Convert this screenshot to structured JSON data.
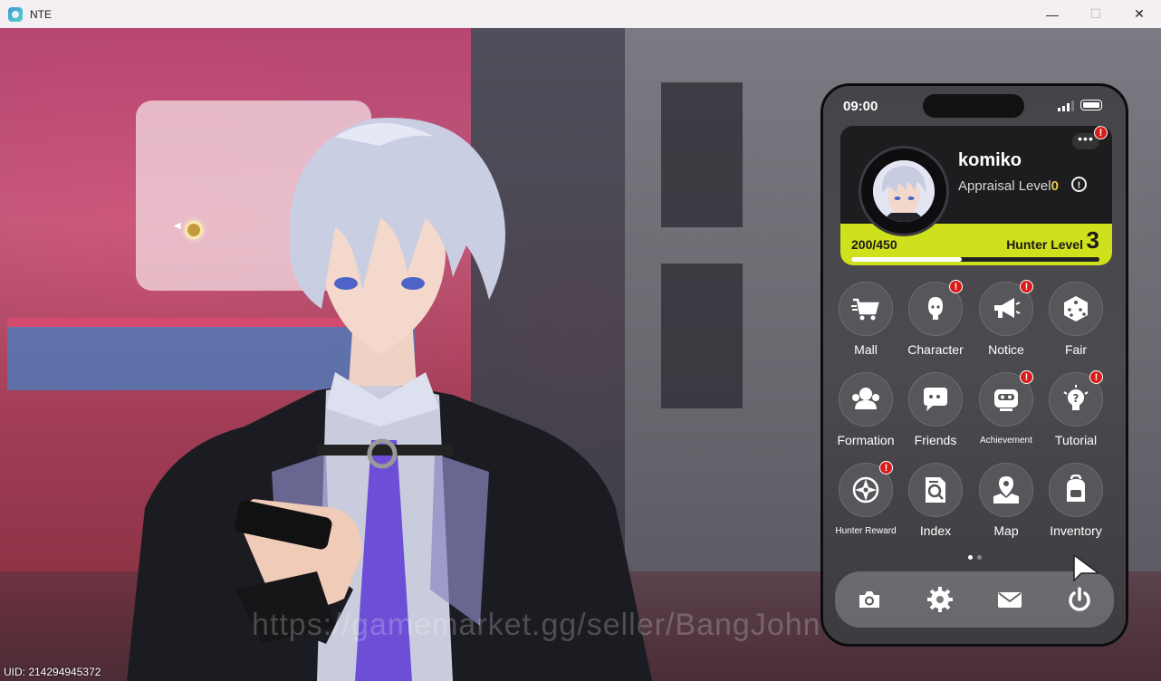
{
  "window": {
    "title": "NTE",
    "minimize": "—",
    "maximize": "☐",
    "close": "✕"
  },
  "scene": {
    "watermark": "https://gamemarket.gg/seller/BangJohn",
    "uid": "UID: 214294945372"
  },
  "phone": {
    "time": "09:00",
    "profile": {
      "username": "komiko",
      "appraisal_label": "Appraisal Level",
      "appraisal_level": "0",
      "exp": "200/450",
      "exp_fraction": 0.444,
      "hunter_level_label": "Hunter Level",
      "hunter_level": "3",
      "more_badge": "!"
    },
    "apps": [
      {
        "label": "Mall",
        "icon": "cart-icon",
        "badge": ""
      },
      {
        "label": "Character",
        "icon": "character-icon",
        "badge": "!"
      },
      {
        "label": "Notice",
        "icon": "megaphone-icon",
        "badge": "!"
      },
      {
        "label": "Fair",
        "icon": "dice-icon",
        "badge": ""
      },
      {
        "label": "Formation",
        "icon": "formation-icon",
        "badge": ""
      },
      {
        "label": "Friends",
        "icon": "chat-icon",
        "badge": ""
      },
      {
        "label": "Achievement",
        "icon": "achievement-icon",
        "badge": "!"
      },
      {
        "label": "Tutorial",
        "icon": "lightbulb-icon",
        "badge": "!"
      },
      {
        "label": "Hunter Reward",
        "icon": "compass-icon",
        "badge": "!"
      },
      {
        "label": "Index",
        "icon": "index-icon",
        "badge": ""
      },
      {
        "label": "Map",
        "icon": "map-icon",
        "badge": ""
      },
      {
        "label": "Inventory",
        "icon": "backpack-icon",
        "badge": ""
      }
    ],
    "dock": [
      "camera-icon",
      "settings-icon",
      "mail-icon",
      "power-icon"
    ],
    "page_indicator": {
      "pages": 2,
      "active": 1
    }
  },
  "colors": {
    "hunter_bar": "#cfe01c",
    "badge": "#d81b1b",
    "appraisal_level": "#e9c848"
  }
}
